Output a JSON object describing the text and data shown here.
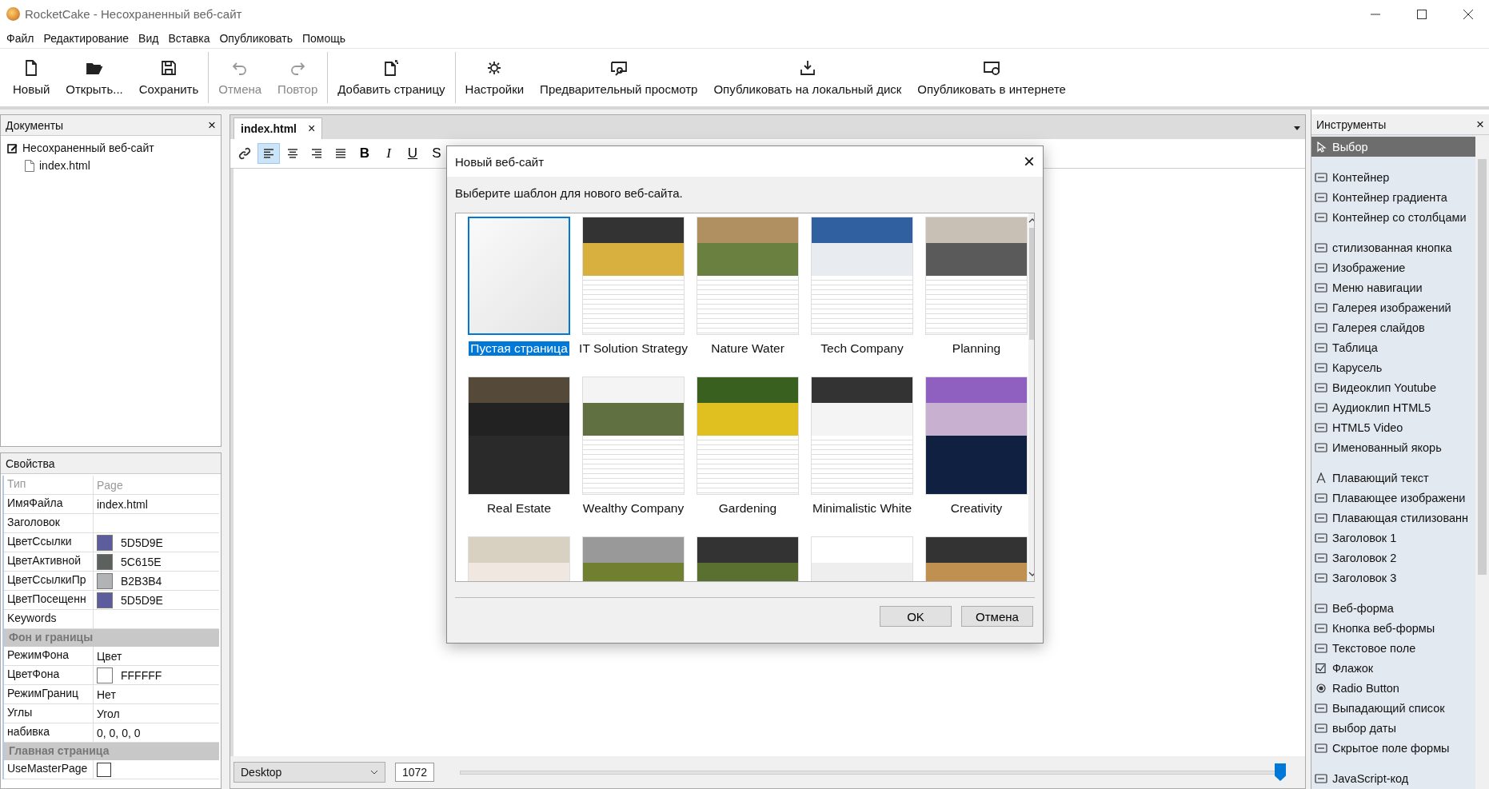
{
  "window": {
    "title": "RocketCake - Несохраненный веб-сайт"
  },
  "menu": [
    "Файл",
    "Редактирование",
    "Вид",
    "Вставка",
    "Опубликовать",
    "Помощь"
  ],
  "toolbar": [
    {
      "label": "Новый",
      "disabled": false,
      "group_end": false
    },
    {
      "label": "Открыть...",
      "disabled": false,
      "group_end": false
    },
    {
      "label": "Сохранить",
      "disabled": false,
      "group_end": true
    },
    {
      "label": "Отмена",
      "disabled": true,
      "group_end": false
    },
    {
      "label": "Повтор",
      "disabled": true,
      "group_end": true
    },
    {
      "label": "Добавить страницу",
      "disabled": false,
      "group_end": true
    },
    {
      "label": "Настройки",
      "disabled": false,
      "group_end": false
    },
    {
      "label": "Предварительный просмотр",
      "disabled": false,
      "group_end": false
    },
    {
      "label": "Опубликовать на локальный диск",
      "disabled": false,
      "group_end": false
    },
    {
      "label": "Опубликовать в интернете",
      "disabled": false,
      "group_end": false
    }
  ],
  "documents": {
    "title": "Документы",
    "close": "×",
    "tree": [
      {
        "label": "Несохраненный веб-сайт",
        "children": [
          {
            "label": "index.html"
          }
        ]
      }
    ]
  },
  "properties": {
    "title": "Свойства",
    "rows": [
      {
        "kind": "head",
        "name": "Тип",
        "value": "Page"
      },
      {
        "kind": "text",
        "name": "ИмяФайла",
        "value": "index.html"
      },
      {
        "kind": "text",
        "name": "Заголовок",
        "value": ""
      },
      {
        "kind": "color",
        "name": "ЦветСсылки",
        "value": "5D5D9E",
        "color": "#5d5d9e"
      },
      {
        "kind": "color",
        "name": "ЦветАктивной",
        "value": "5C615E",
        "color": "#5c615e"
      },
      {
        "kind": "color",
        "name": "ЦветСсылкиПр",
        "value": "B2B3B4",
        "color": "#b2b3b4"
      },
      {
        "kind": "color",
        "name": "ЦветПосещенн",
        "value": "5D5D9E",
        "color": "#5d5d9e"
      },
      {
        "kind": "text",
        "name": "Keywords",
        "value": ""
      },
      {
        "kind": "section",
        "name": "Фон и границы"
      },
      {
        "kind": "text",
        "name": "РежимФона",
        "value": "Цвет"
      },
      {
        "kind": "color",
        "name": "ЦветФона",
        "value": "FFFFFF",
        "color": "#ffffff"
      },
      {
        "kind": "text",
        "name": "РежимГраниц",
        "value": "Нет"
      },
      {
        "kind": "text",
        "name": "Углы",
        "value": "Угол"
      },
      {
        "kind": "text",
        "name": "набивка",
        "value": "0, 0, 0, 0"
      },
      {
        "kind": "section",
        "name": "Главная страница"
      },
      {
        "kind": "checkbox",
        "name": "UseMasterPage",
        "checked": false
      }
    ]
  },
  "editor": {
    "tabs": [
      {
        "label": "index.html",
        "close": "×",
        "selected": true
      }
    ],
    "format_buttons": [
      {
        "kind": "link",
        "selected": false
      },
      {
        "kind": "align-left",
        "selected": true
      },
      {
        "kind": "align-center",
        "selected": false
      },
      {
        "kind": "align-right",
        "selected": false
      },
      {
        "kind": "justify",
        "selected": false
      },
      {
        "kind": "text",
        "label": "B",
        "selected": false
      },
      {
        "kind": "text",
        "label": "I",
        "selected": false
      },
      {
        "kind": "text",
        "label": "U",
        "selected": false
      },
      {
        "kind": "text",
        "label": "S",
        "selected": false
      }
    ],
    "view_select": "Desktop",
    "width_value": "1072",
    "zoom": {
      "level": 1
    }
  },
  "dialog": {
    "title": "Новый веб-сайт",
    "close": "×",
    "prompt": "Выберите шаблон для нового веб-сайта.",
    "templates": [
      {
        "label": "Пустая страница",
        "selected": true
      },
      {
        "label": "IT Solution Strategy",
        "selected": false
      },
      {
        "label": "Nature Water",
        "selected": false
      },
      {
        "label": "Tech Company",
        "selected": false
      },
      {
        "label": "Planning",
        "selected": false
      },
      {
        "label": "Real Estate",
        "selected": false
      },
      {
        "label": "Wealthy Company",
        "selected": false
      },
      {
        "label": "Gardening",
        "selected": false
      },
      {
        "label": "Minimalistic White",
        "selected": false
      },
      {
        "label": "Creativity",
        "selected": false
      },
      {
        "selected": false
      },
      {
        "selected": false
      },
      {
        "selected": false
      },
      {
        "selected": false
      },
      {
        "selected": false
      }
    ],
    "buttons": [
      "OK",
      "Отмена"
    ]
  },
  "tools": {
    "title": "Инструменты",
    "close": "×",
    "groups": [
      [
        {
          "label": "Выбор",
          "selected": true
        }
      ],
      [
        {
          "label": "Контейнер",
          "selected": false
        },
        {
          "label": "Контейнер градиента",
          "selected": false
        },
        {
          "label": "Контейнер со столбцами",
          "selected": false
        }
      ],
      [
        {
          "label": "стилизованная кнопка",
          "selected": false
        },
        {
          "label": "Изображение",
          "selected": false
        },
        {
          "label": "Меню навигации",
          "selected": false
        },
        {
          "label": "Галерея изображений",
          "selected": false
        },
        {
          "label": "Галерея слайдов",
          "selected": false
        },
        {
          "label": "Таблица",
          "selected": false
        },
        {
          "label": "Карусель",
          "selected": false
        },
        {
          "label": "Видеоклип Youtube",
          "selected": false
        },
        {
          "label": "Аудиоклип HTML5",
          "selected": false
        },
        {
          "label": "HTML5 Video",
          "selected": false
        },
        {
          "label": "Именованный якорь",
          "selected": false
        }
      ],
      [
        {
          "label": "Плавающий текст",
          "selected": false
        },
        {
          "label": "Плавающее изображени",
          "selected": false
        },
        {
          "label": "Плавающая стилизованн",
          "selected": false
        },
        {
          "label": "Заголовок 1",
          "selected": false
        },
        {
          "label": "Заголовок 2",
          "selected": false
        },
        {
          "label": "Заголовок 3",
          "selected": false
        }
      ],
      [
        {
          "label": "Веб-форма",
          "selected": false
        },
        {
          "label": "Кнопка веб-формы",
          "selected": false
        },
        {
          "label": "Текстовое поле",
          "selected": false
        },
        {
          "label": "Флажок",
          "selected": false
        },
        {
          "label": "Radio Button",
          "selected": false
        },
        {
          "label": "Выпадающий список",
          "selected": false
        },
        {
          "label": "выбор даты",
          "selected": false
        },
        {
          "label": "Скрытое поле формы",
          "selected": false
        }
      ],
      [
        {
          "label": "JavaScript-код",
          "selected": false
        }
      ]
    ]
  }
}
